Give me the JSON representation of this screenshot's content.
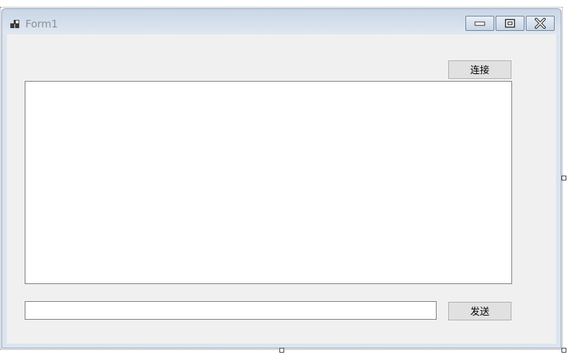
{
  "window": {
    "title": "Form1"
  },
  "caption_buttons": {
    "minimize": "minimize-icon",
    "maximize": "maximize-icon",
    "close": "close-icon"
  },
  "buttons": {
    "connect_label": "连接",
    "send_label": "发送"
  },
  "fields": {
    "log_text": "",
    "message_text": ""
  },
  "colors": {
    "titlebar": "#c9d6e6",
    "client_background": "#f0f0f0",
    "button_face": "#e1e1e1",
    "title_text": "#8a8f96"
  }
}
